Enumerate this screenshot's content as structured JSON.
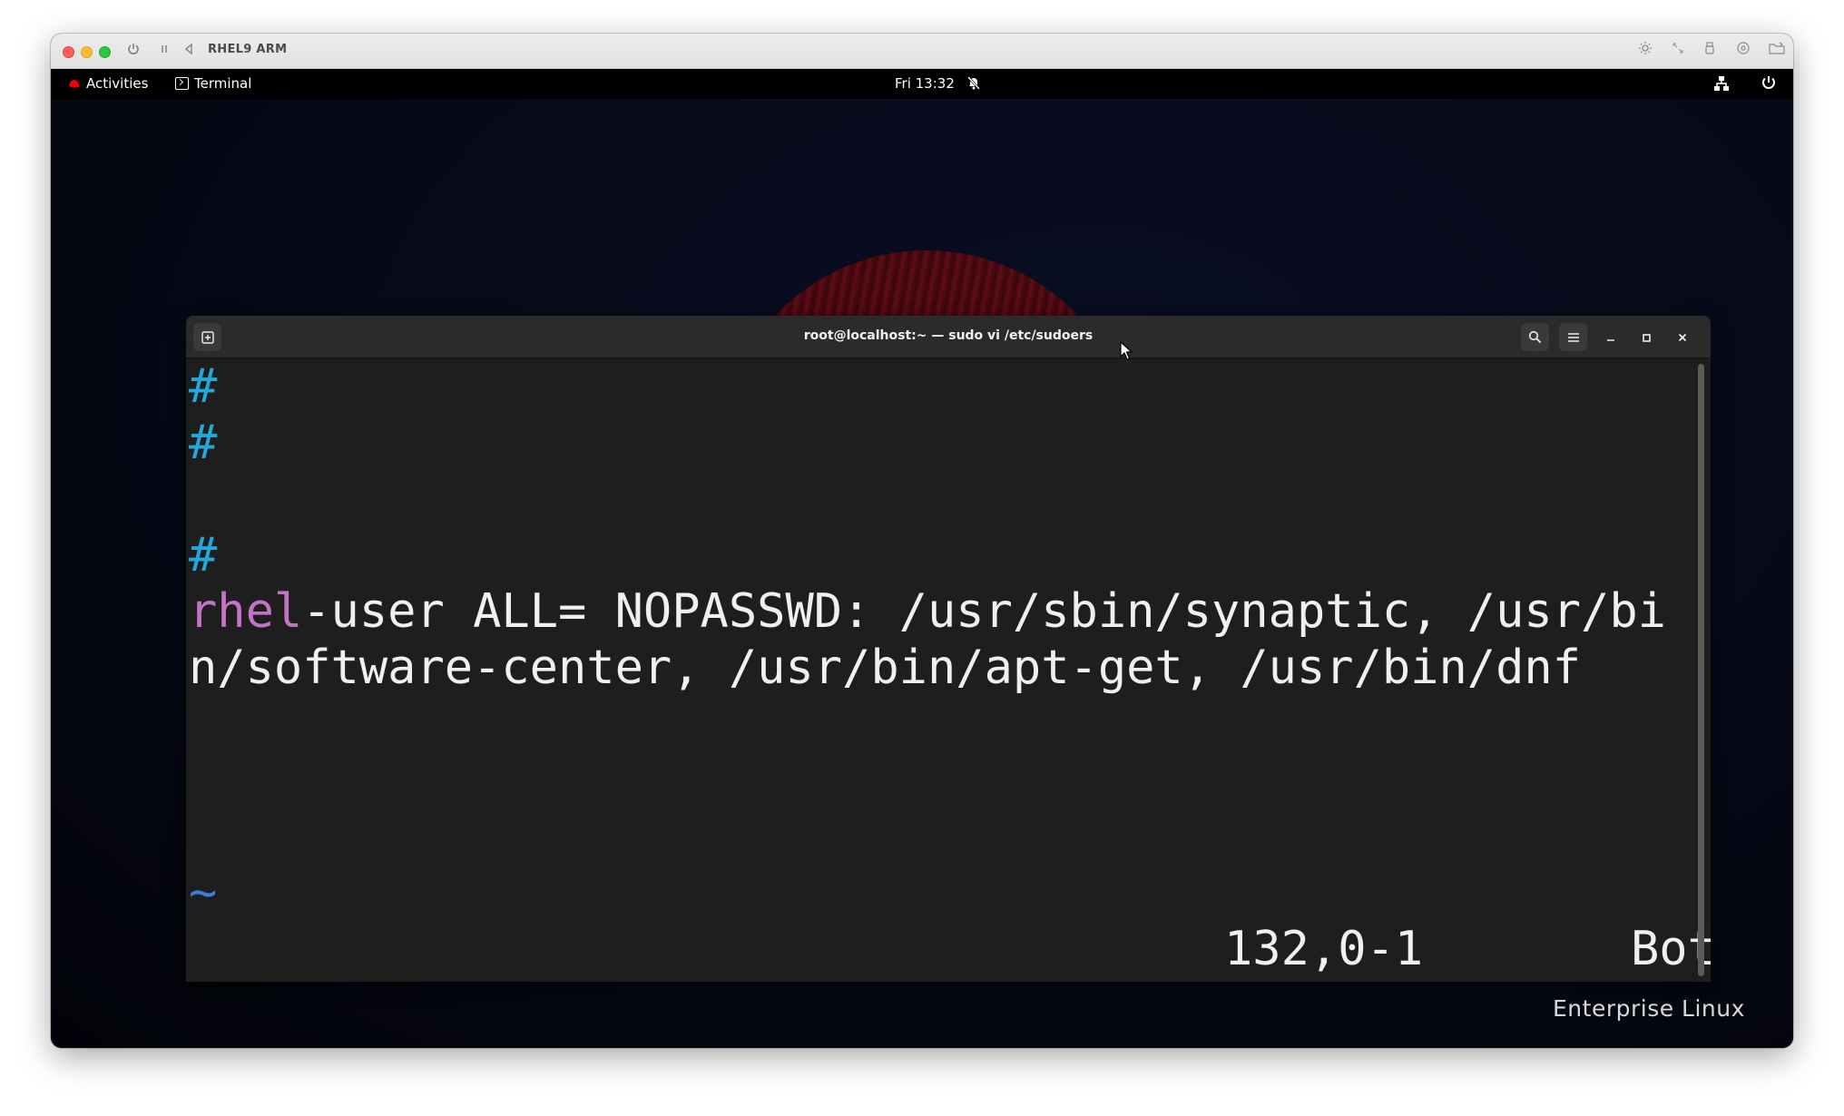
{
  "vm_window": {
    "title": "RHEL9 ARM",
    "toolbar_icons": [
      "power-icon",
      "pause-icon",
      "back-icon",
      "brightness-icon",
      "resize-icon",
      "usb-icon",
      "disk-icon",
      "folder-share-icon"
    ]
  },
  "gnome_bar": {
    "activities_label": "Activities",
    "app_menu_label": "Terminal",
    "clock": "Fri 13:32",
    "status_icons": [
      "notifications-muted-icon",
      "network-icon",
      "power-icon"
    ]
  },
  "desktop": {
    "brand_text": "Enterprise Linux"
  },
  "terminal": {
    "title": "root@localhost:~ — sudo vi /etc/sudoers",
    "lines": [
      {
        "kind": "comment",
        "text": "#"
      },
      {
        "kind": "comment",
        "text": "#"
      },
      {
        "kind": "blank",
        "text": ""
      },
      {
        "kind": "comment",
        "text": "#"
      },
      {
        "kind": "rule",
        "user": "rhel",
        "rest": "-user ALL= NOPASSWD: /usr/sbin/synaptic, /usr/bi"
      },
      {
        "kind": "text",
        "text": "n/software-center, /usr/bin/apt-get, /usr/bin/dnf"
      }
    ],
    "tilde": "~",
    "status": {
      "position": "132,0-1",
      "scroll": "Bot"
    }
  }
}
